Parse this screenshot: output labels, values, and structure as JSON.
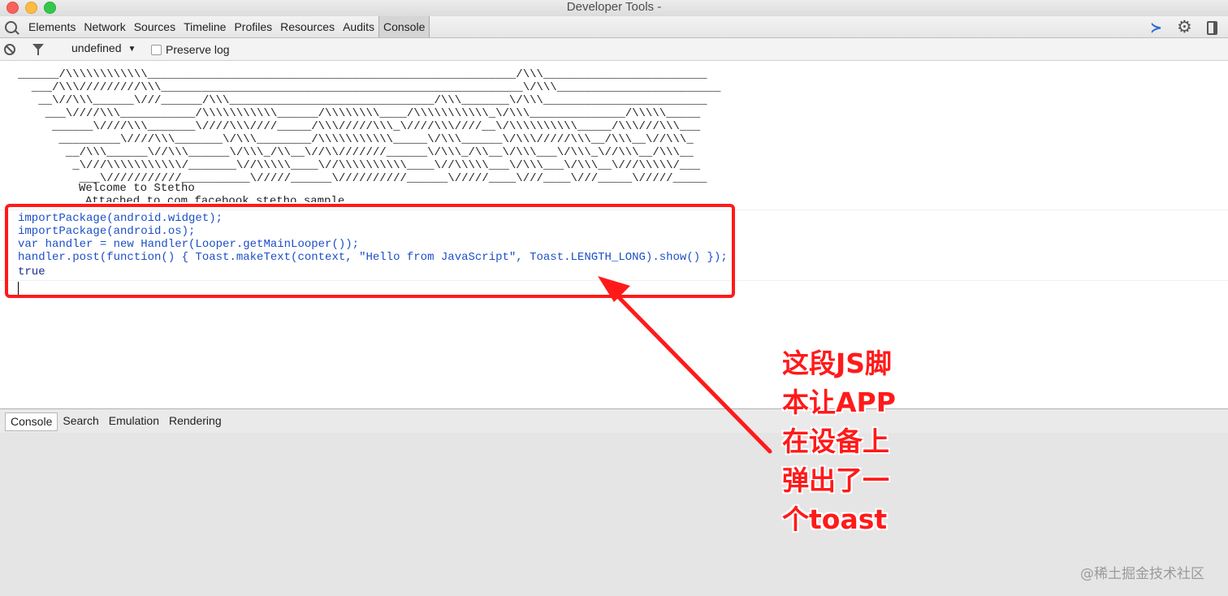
{
  "window": {
    "title": "Developer Tools -"
  },
  "tabs": [
    "Elements",
    "Network",
    "Sources",
    "Timeline",
    "Profiles",
    "Resources",
    "Audits",
    "Console"
  ],
  "toolbar": {
    "context": "undefined",
    "preserve_log": "Preserve log"
  },
  "console": {
    "ascii_art": "______/\\\\\\\\\\\\\\\\\\\\\\\\______________________________________________________/\\\\\\________________________\n  ___/\\\\\\/////////\\\\\\_____________________________________________________\\/\\\\\\________________________\n   __\\//\\\\\\______\\///______/\\\\\\______________________________/\\\\\\_______\\/\\\\\\________________________\n    ___\\////\\\\\\___________/\\\\\\\\\\\\\\\\\\\\\\______/\\\\\\\\\\\\\\\\____/\\\\\\\\\\\\\\\\\\\\\\_\\/\\\\\\______________/\\\\\\\\\\_____\n     ______\\////\\\\\\_______\\////\\\\\\////_____/\\\\\\/////\\\\\\_\\////\\\\\\////__\\/\\\\\\\\\\\\\\\\\\\\_____/\\\\\\///\\\\\\___\n      _________\\////\\\\\\_______\\/\\\\\\________/\\\\\\\\\\\\\\\\\\\\\\_____\\/\\\\\\______\\/\\\\\\/////\\\\\\__/\\\\\\__\\//\\\\\\_\n       __/\\\\\\______\\//\\\\\\______\\/\\\\\\_/\\\\__\\//\\\\///////______\\/\\\\\\_/\\\\__\\/\\\\\\___\\/\\\\\\_\\//\\\\\\__/\\\\\\__\n        _\\///\\\\\\\\\\\\\\\\\\\\\\/_______\\//\\\\\\\\\\____\\//\\\\\\\\\\\\\\\\\\\\____\\//\\\\\\\\\\___\\/\\\\\\___\\/\\\\\\__\\///\\\\\\\\\\/___\n         ___\\///////////__________\\/////______\\//////////______\\/////____\\///____\\///_____\\/////_____",
    "welcome": "Welcome to Stetho",
    "attached": "Attached to com.facebook.stetho.sample",
    "code_lines": [
      "importPackage(android.widget);",
      "importPackage(android.os);",
      "var handler = new Handler(Looper.getMainLooper());",
      "handler.post(function() { Toast.makeText(context, \"Hello from JavaScript\", Toast.LENGTH_LONG).show() });"
    ],
    "result": "true"
  },
  "drawer_tabs": [
    "Console",
    "Search",
    "Emulation",
    "Rendering"
  ],
  "annotation": {
    "lines": [
      "这段JS脚",
      "本让APP",
      "在设备上",
      "弹出了一",
      "个toast"
    ],
    "color": "#ff1a1a"
  },
  "watermark": "@稀土掘金技术社区",
  "icons": {
    "search": "search-icon",
    "drawer": "show-drawer-icon",
    "settings": "gear-icon",
    "dock": "dock-icon",
    "clear": "clear-console-icon",
    "filter": "filter-icon"
  }
}
